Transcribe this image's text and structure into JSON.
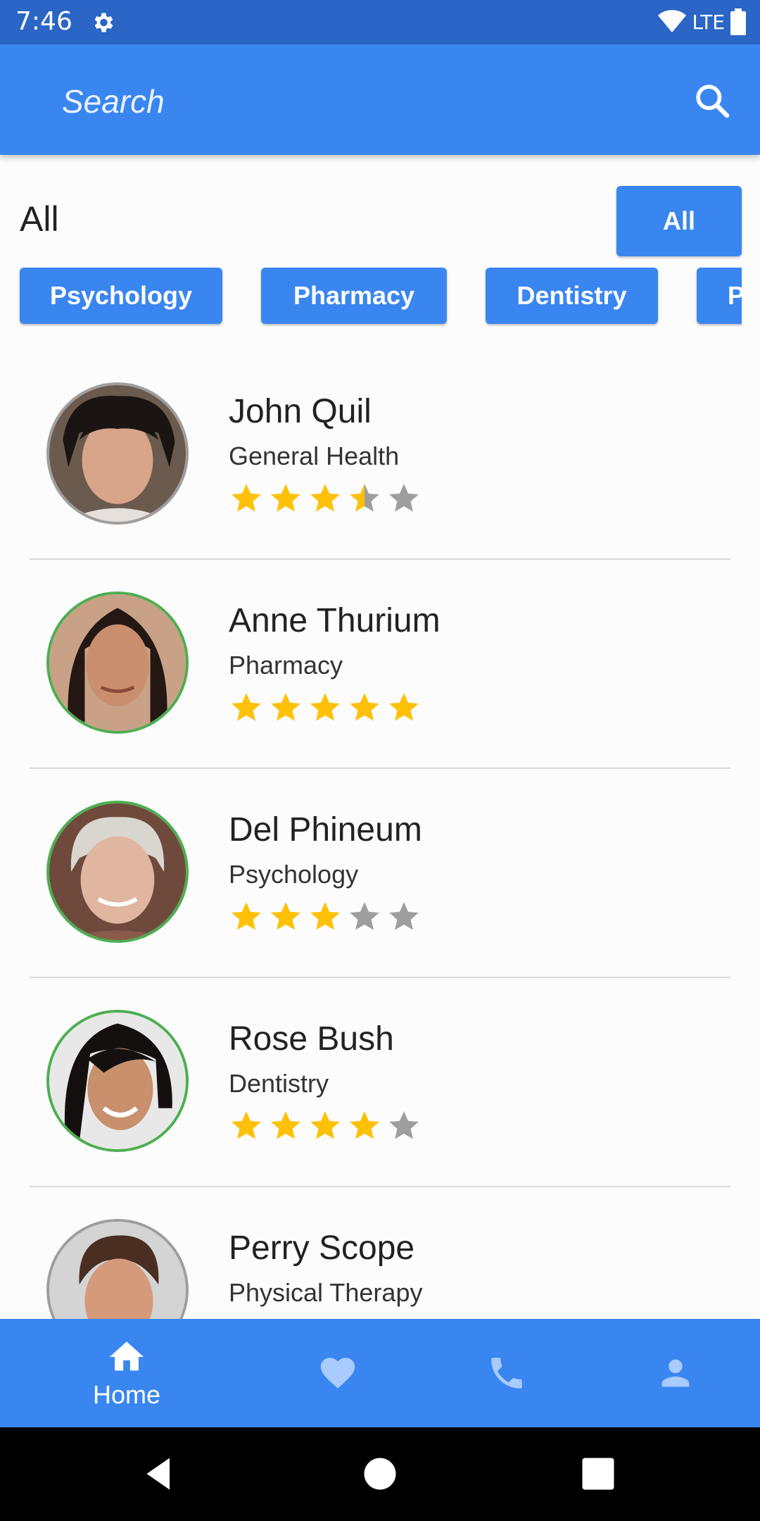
{
  "status_bar": {
    "time": "7:46",
    "network": "LTE"
  },
  "app_bar": {
    "search_placeholder": "Search"
  },
  "filter": {
    "title": "All",
    "all_button": "All",
    "categories": [
      "Psychology",
      "Pharmacy",
      "Dentistry",
      "Physical Therapy"
    ]
  },
  "doctors": [
    {
      "name": "John Quil",
      "specialty": "General Health",
      "rating": 3.5
    },
    {
      "name": "Anne Thurium",
      "specialty": "Pharmacy",
      "rating": 5
    },
    {
      "name": "Del Phineum",
      "specialty": "Psychology",
      "rating": 3
    },
    {
      "name": "Rose Bush",
      "specialty": "Dentistry",
      "rating": 4
    },
    {
      "name": "Perry Scope",
      "specialty": "Physical Therapy",
      "rating": null
    }
  ],
  "bottom_nav": {
    "home_label": "Home",
    "items": [
      "home-icon",
      "heart-icon",
      "phone-icon",
      "person-icon"
    ]
  },
  "colors": {
    "primary": "#3a86f0",
    "status_bar": "#2b66c6",
    "star": "#ffc107",
    "star_empty": "#9e9e9e",
    "avatar_border": "#4caf50"
  }
}
